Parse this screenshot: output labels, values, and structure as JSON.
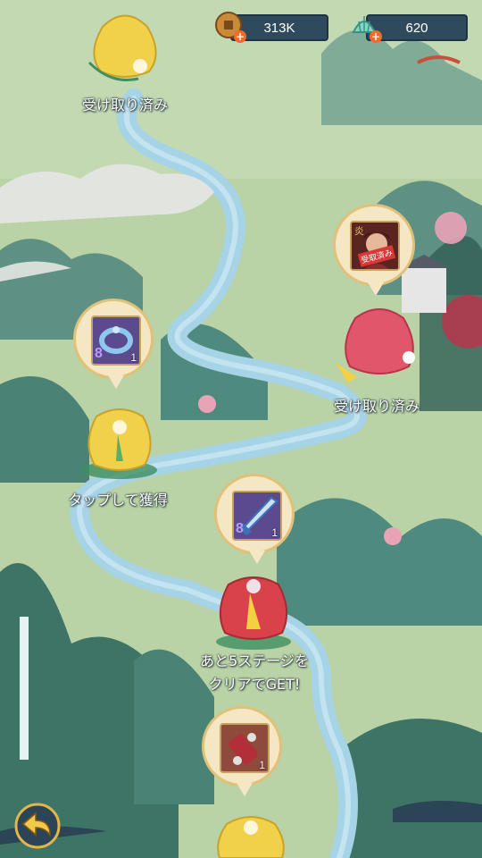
{
  "currency": {
    "coins": {
      "icon": "coin-icon",
      "value": "313K"
    },
    "gems": {
      "icon": "shell-gem-icon",
      "value": "620"
    },
    "plus_symbol": "+"
  },
  "rewards": [
    {
      "item_icon": "golden-reward-bag-icon",
      "status": "受け取り済み"
    },
    {
      "item_icon": "hero-portrait-icon",
      "stamp": "受取済み",
      "element_mark": "炎",
      "status": "受け取り済み"
    },
    {
      "item_icon": "ring-icon",
      "tier_mark": "8",
      "quantity": "1",
      "status": "タップして獲得"
    },
    {
      "item_icon": "sword-icon",
      "tier_mark": "8",
      "quantity": "1",
      "status_line1": "あと5ステージを",
      "status_line2": "クリアでGET!"
    },
    {
      "item_icon": "scroll-icon",
      "quantity": "1"
    }
  ],
  "colors": {
    "river": "#a7d3e6",
    "land": "#b9d2a6",
    "mountain": "#4f8a7e",
    "bag_gold": "#f2d14a",
    "bag_red": "#d9414b"
  },
  "back_icon": "back-arrow-icon"
}
